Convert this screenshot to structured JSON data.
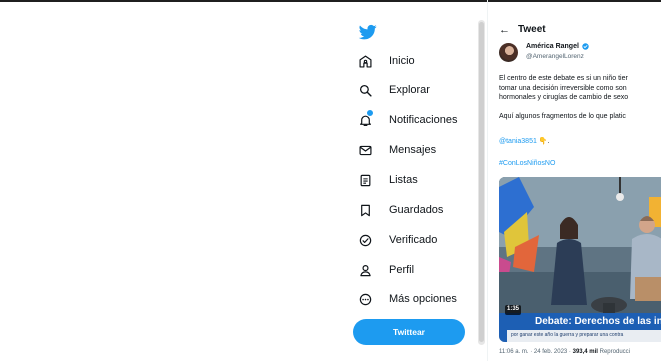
{
  "sidebar": {
    "items": [
      {
        "label": "Inicio",
        "icon": "home-icon"
      },
      {
        "label": "Explorar",
        "icon": "search-icon"
      },
      {
        "label": "Notificaciones",
        "icon": "bell-icon"
      },
      {
        "label": "Mensajes",
        "icon": "envelope-icon"
      },
      {
        "label": "Listas",
        "icon": "list-icon"
      },
      {
        "label": "Guardados",
        "icon": "bookmark-icon"
      },
      {
        "label": "Verificado",
        "icon": "verified-icon"
      },
      {
        "label": "Perfil",
        "icon": "person-icon"
      },
      {
        "label": "Más opciones",
        "icon": "more-icon"
      }
    ],
    "tweet_button": "Twittear"
  },
  "header": {
    "back_icon": "←",
    "title": "Tweet"
  },
  "tweet": {
    "author_name": "América Rangel",
    "author_handle": "@AmerangelLorenz",
    "text_lines": [
      "El centro de este debate es si un niño tier",
      "tomar una decisión irreversible como son",
      "hormonales y cirugías de cambio de sexo"
    ],
    "text2_prefix": "Aquí algunos fragmentos de lo que platic",
    "mention": "@tania3851",
    "mention_suffix": " 👇.",
    "hashtag": "#ConLosNiñosNO",
    "media": {
      "video_time": "1:35",
      "banner_text": "Debate: Derechos de las infa",
      "ticker_text": "por ganar este año la guerra y preparar una contra"
    },
    "timestamp_prefix": "11:06 a. m. · 24 feb. 2023 · ",
    "views_count": "393,4 mil",
    "views_label": " Reproducci"
  },
  "colors": {
    "accent": "#1d9bf0",
    "text": "#0f1419",
    "muted": "#536471"
  }
}
